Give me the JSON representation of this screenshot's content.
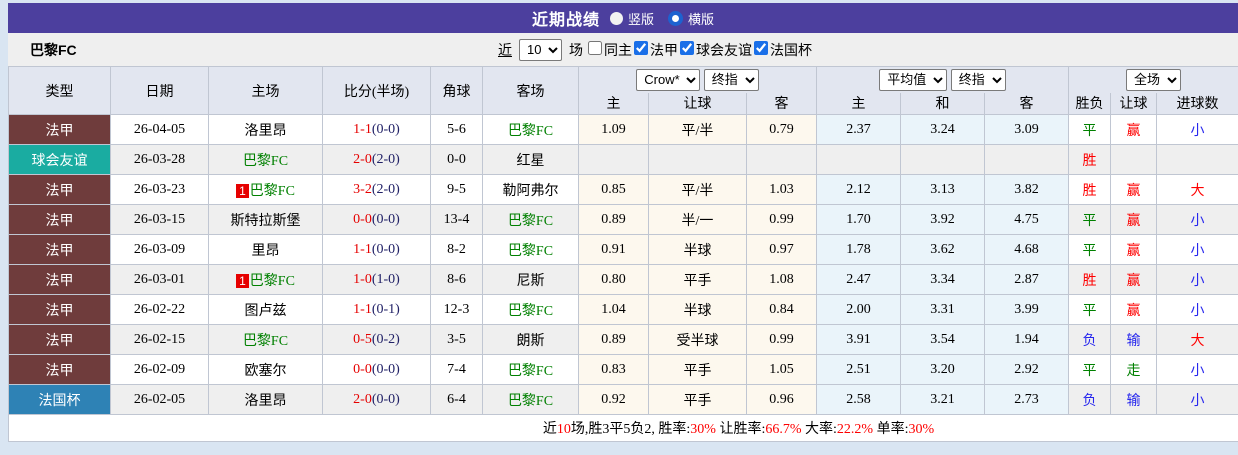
{
  "topbar": {
    "title": "近期战绩",
    "radios": [
      {
        "label": "竖版",
        "checked": false
      },
      {
        "label": "横版",
        "checked": true
      }
    ]
  },
  "filterbar": {
    "team": "巴黎FC",
    "near_label": "近",
    "games_value": "10",
    "games_unit": "场",
    "checkboxes": [
      {
        "label": "同主",
        "checked": false
      },
      {
        "label": "法甲",
        "checked": true
      },
      {
        "label": "球会友谊",
        "checked": true
      },
      {
        "label": "法国杯",
        "checked": true
      }
    ]
  },
  "table": {
    "col_headers": [
      "类型",
      "日期",
      "主场",
      "比分(半场)",
      "角球",
      "客场"
    ],
    "group_selects": {
      "handicap": [
        "Crow*",
        "终指"
      ],
      "average": [
        "平均值",
        "终指"
      ],
      "result": [
        "全场"
      ]
    },
    "sub_headers": [
      "主",
      "让球",
      "客",
      "主",
      "和",
      "客",
      "胜负",
      "让球",
      "进球数"
    ],
    "palette": {
      "ligue1": "#6f3c3c",
      "friendly": "#1aaca1",
      "cup": "#2e82b5"
    },
    "rows": [
      {
        "league": "法甲",
        "league_bg": "#6f3c3c",
        "date": "26-04-05",
        "home": {
          "badge": "",
          "name": "洛里昂",
          "green": false
        },
        "score": {
          "full": "1-1",
          "half": "(0-0)"
        },
        "corners": "5-6",
        "away": {
          "badge": "",
          "name": "巴黎FC",
          "green": true
        },
        "handicap": [
          "1.09",
          "平/半",
          "0.79"
        ],
        "avg": [
          "2.37",
          "3.24",
          "3.09"
        ],
        "outcome": [
          [
            "平",
            "green"
          ],
          [
            "赢",
            "red"
          ],
          [
            "小",
            "blue"
          ]
        ]
      },
      {
        "league": "球会友谊",
        "league_bg": "#1aaca1",
        "date": "26-03-28",
        "home": {
          "badge": "",
          "name": "巴黎FC",
          "green": true
        },
        "score": {
          "full": "2-0",
          "half": "(2-0)"
        },
        "corners": "0-0",
        "away": {
          "badge": "",
          "name": "红星",
          "green": false
        },
        "handicap": [
          "",
          "",
          ""
        ],
        "avg": [
          "",
          "",
          ""
        ],
        "outcome": [
          [
            "胜",
            "red"
          ],
          [
            "",
            "red"
          ],
          [
            "",
            "red"
          ]
        ]
      },
      {
        "league": "法甲",
        "league_bg": "#6f3c3c",
        "date": "26-03-23",
        "home": {
          "badge": "1",
          "name": "巴黎FC",
          "green": true
        },
        "score": {
          "full": "3-2",
          "half": "(2-0)"
        },
        "corners": "9-5",
        "away": {
          "badge": "",
          "name": "勒阿弗尔",
          "green": false
        },
        "handicap": [
          "0.85",
          "平/半",
          "1.03"
        ],
        "avg": [
          "2.12",
          "3.13",
          "3.82"
        ],
        "outcome": [
          [
            "胜",
            "red"
          ],
          [
            "赢",
            "red"
          ],
          [
            "大",
            "red"
          ]
        ]
      },
      {
        "league": "法甲",
        "league_bg": "#6f3c3c",
        "date": "26-03-15",
        "home": {
          "badge": "",
          "name": "斯特拉斯堡",
          "green": false
        },
        "score": {
          "full": "0-0",
          "half": "(0-0)"
        },
        "corners": "13-4",
        "away": {
          "badge": "",
          "name": "巴黎FC",
          "green": true
        },
        "handicap": [
          "0.89",
          "半/一",
          "0.99"
        ],
        "avg": [
          "1.70",
          "3.92",
          "4.75"
        ],
        "outcome": [
          [
            "平",
            "green"
          ],
          [
            "赢",
            "red"
          ],
          [
            "小",
            "blue"
          ]
        ]
      },
      {
        "league": "法甲",
        "league_bg": "#6f3c3c",
        "date": "26-03-09",
        "home": {
          "badge": "",
          "name": "里昂",
          "green": false
        },
        "score": {
          "full": "1-1",
          "half": "(0-0)"
        },
        "corners": "8-2",
        "away": {
          "badge": "",
          "name": "巴黎FC",
          "green": true
        },
        "handicap": [
          "0.91",
          "半球",
          "0.97"
        ],
        "avg": [
          "1.78",
          "3.62",
          "4.68"
        ],
        "outcome": [
          [
            "平",
            "green"
          ],
          [
            "赢",
            "red"
          ],
          [
            "小",
            "blue"
          ]
        ]
      },
      {
        "league": "法甲",
        "league_bg": "#6f3c3c",
        "date": "26-03-01",
        "home": {
          "badge": "1",
          "name": "巴黎FC",
          "green": true
        },
        "score": {
          "full": "1-0",
          "half": "(1-0)"
        },
        "corners": "8-6",
        "away": {
          "badge": "",
          "name": "尼斯",
          "green": false
        },
        "handicap": [
          "0.80",
          "平手",
          "1.08"
        ],
        "avg": [
          "2.47",
          "3.34",
          "2.87"
        ],
        "outcome": [
          [
            "胜",
            "red"
          ],
          [
            "赢",
            "red"
          ],
          [
            "小",
            "blue"
          ]
        ]
      },
      {
        "league": "法甲",
        "league_bg": "#6f3c3c",
        "date": "26-02-22",
        "home": {
          "badge": "",
          "name": "图卢兹",
          "green": false
        },
        "score": {
          "full": "1-1",
          "half": "(0-1)"
        },
        "corners": "12-3",
        "away": {
          "badge": "",
          "name": "巴黎FC",
          "green": true
        },
        "handicap": [
          "1.04",
          "半球",
          "0.84"
        ],
        "avg": [
          "2.00",
          "3.31",
          "3.99"
        ],
        "outcome": [
          [
            "平",
            "green"
          ],
          [
            "赢",
            "red"
          ],
          [
            "小",
            "blue"
          ]
        ]
      },
      {
        "league": "法甲",
        "league_bg": "#6f3c3c",
        "date": "26-02-15",
        "home": {
          "badge": "",
          "name": "巴黎FC",
          "green": true
        },
        "score": {
          "full": "0-5",
          "half": "(0-2)"
        },
        "corners": "3-5",
        "away": {
          "badge": "",
          "name": "朗斯",
          "green": false
        },
        "handicap": [
          "0.89",
          "受半球",
          "0.99"
        ],
        "avg": [
          "3.91",
          "3.54",
          "1.94"
        ],
        "outcome": [
          [
            "负",
            "blue"
          ],
          [
            "输",
            "blue"
          ],
          [
            "大",
            "red"
          ]
        ]
      },
      {
        "league": "法甲",
        "league_bg": "#6f3c3c",
        "date": "26-02-09",
        "home": {
          "badge": "",
          "name": "欧塞尔",
          "green": false
        },
        "score": {
          "full": "0-0",
          "half": "(0-0)"
        },
        "corners": "7-4",
        "away": {
          "badge": "",
          "name": "巴黎FC",
          "green": true
        },
        "handicap": [
          "0.83",
          "平手",
          "1.05"
        ],
        "avg": [
          "2.51",
          "3.20",
          "2.92"
        ],
        "outcome": [
          [
            "平",
            "green"
          ],
          [
            "走",
            "green"
          ],
          [
            "小",
            "blue"
          ]
        ]
      },
      {
        "league": "法国杯",
        "league_bg": "#2e82b5",
        "date": "26-02-05",
        "home": {
          "badge": "",
          "name": "洛里昂",
          "green": false
        },
        "score": {
          "full": "2-0",
          "half": "(0-0)"
        },
        "corners": "6-4",
        "away": {
          "badge": "",
          "name": "巴黎FC",
          "green": true
        },
        "handicap": [
          "0.92",
          "平手",
          "0.96"
        ],
        "avg": [
          "2.58",
          "3.21",
          "2.73"
        ],
        "outcome": [
          [
            "负",
            "blue"
          ],
          [
            "输",
            "blue"
          ],
          [
            "小",
            "blue"
          ]
        ]
      }
    ]
  },
  "footer": {
    "segments": [
      [
        "近",
        "black"
      ],
      [
        "10",
        "red"
      ],
      [
        "场,胜3平5负2, 胜率:",
        "black"
      ],
      [
        "30%",
        "red"
      ],
      [
        " 让胜率:",
        "black"
      ],
      [
        "66.7%",
        "red"
      ],
      [
        " 大率:",
        "black"
      ],
      [
        "22.2%",
        "red"
      ],
      [
        " 单率:",
        "black"
      ],
      [
        "30%",
        "red"
      ]
    ]
  }
}
